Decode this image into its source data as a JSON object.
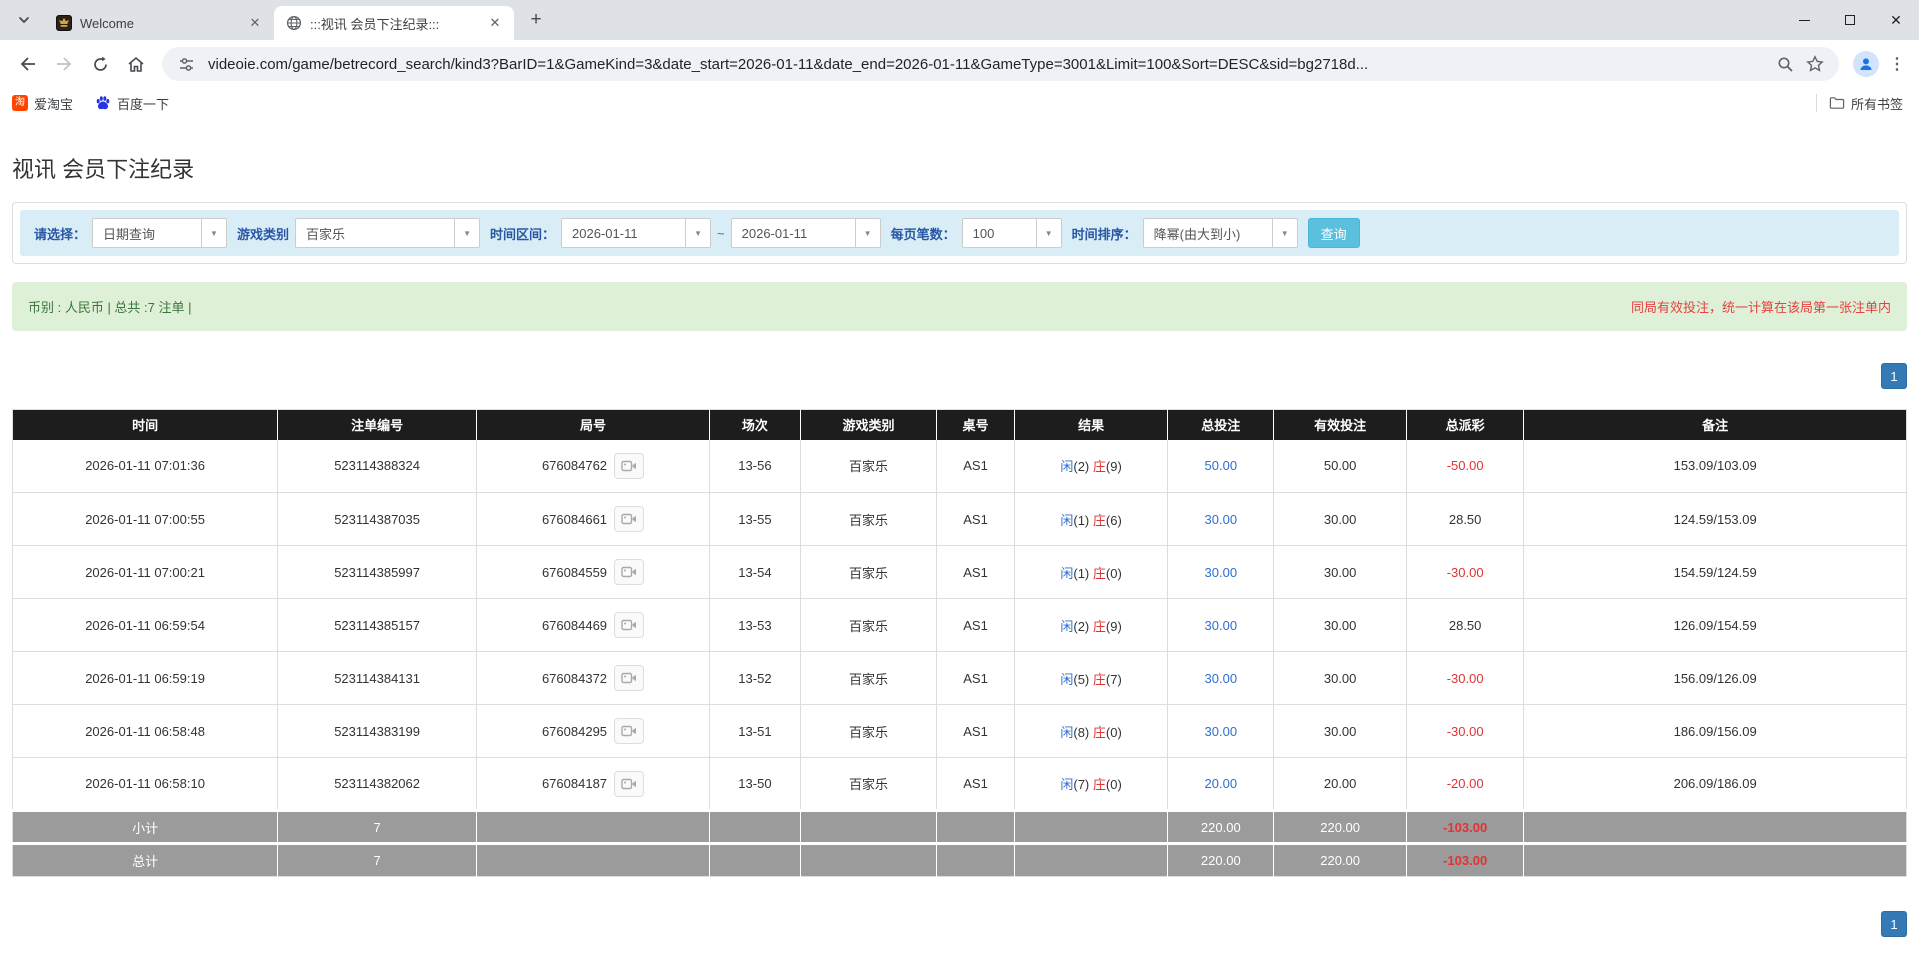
{
  "browser": {
    "tabs": [
      {
        "title": "Welcome"
      },
      {
        "title": ":::视讯 会员下注纪录:::"
      }
    ],
    "url": "videoie.com/game/betrecord_search/kind3?BarID=1&GameKind=3&date_start=2026-01-11&date_end=2026-01-11&GameType=3001&Limit=100&Sort=DESC&sid=bg2718d...",
    "bookmarks": [
      {
        "label": "爱淘宝",
        "icon_text": "淘"
      },
      {
        "label": "百度一下"
      }
    ],
    "all_bookmarks_label": "所有书签"
  },
  "page": {
    "title": "视讯 会员下注纪录",
    "filters": {
      "select_label": "请选择：",
      "select_value": "日期查询",
      "game_kind_label": "游戏类别",
      "game_kind_value": "百家乐",
      "date_range_label": "时间区间：",
      "date_start": "2026-01-11",
      "date_separator": "~",
      "date_end": "2026-01-11",
      "per_page_label": "每页笔数：",
      "per_page_value": "100",
      "sort_label": "时间排序：",
      "sort_value": "降幂(由大到小)",
      "search_button": "查询"
    },
    "summary": {
      "left": "币别 : 人民币 | 总共 :7 注单 |",
      "right": "同局有效投注，统一计算在该局第一张注单内"
    },
    "pagination": "1",
    "table": {
      "headers": [
        "时间",
        "注单编号",
        "局号",
        "场次",
        "游戏类别",
        "桌号",
        "结果",
        "总投注",
        "有效投注",
        "总派彩",
        "备注"
      ],
      "rows": [
        {
          "time": "2026-01-11 07:01:36",
          "bet_no": "523114388324",
          "round_no": "676084762",
          "session": "13-56",
          "game": "百家乐",
          "table": "AS1",
          "player": "闲",
          "player_score": "(2)",
          "banker": "庄",
          "banker_score": "(9)",
          "total_bet": "50.00",
          "valid_bet": "50.00",
          "payout": "-50.00",
          "note": "153.09/103.09"
        },
        {
          "time": "2026-01-11 07:00:55",
          "bet_no": "523114387035",
          "round_no": "676084661",
          "session": "13-55",
          "game": "百家乐",
          "table": "AS1",
          "player": "闲",
          "player_score": "(1)",
          "banker": "庄",
          "banker_score": "(6)",
          "total_bet": "30.00",
          "valid_bet": "30.00",
          "payout": "28.50",
          "note": "124.59/153.09"
        },
        {
          "time": "2026-01-11 07:00:21",
          "bet_no": "523114385997",
          "round_no": "676084559",
          "session": "13-54",
          "game": "百家乐",
          "table": "AS1",
          "player": "闲",
          "player_score": "(1)",
          "banker": "庄",
          "banker_score": "(0)",
          "total_bet": "30.00",
          "valid_bet": "30.00",
          "payout": "-30.00",
          "note": "154.59/124.59"
        },
        {
          "time": "2026-01-11 06:59:54",
          "bet_no": "523114385157",
          "round_no": "676084469",
          "session": "13-53",
          "game": "百家乐",
          "table": "AS1",
          "player": "闲",
          "player_score": "(2)",
          "banker": "庄",
          "banker_score": "(9)",
          "total_bet": "30.00",
          "valid_bet": "30.00",
          "payout": "28.50",
          "note": "126.09/154.59"
        },
        {
          "time": "2026-01-11 06:59:19",
          "bet_no": "523114384131",
          "round_no": "676084372",
          "session": "13-52",
          "game": "百家乐",
          "table": "AS1",
          "player": "闲",
          "player_score": "(5)",
          "banker": "庄",
          "banker_score": "(7)",
          "total_bet": "30.00",
          "valid_bet": "30.00",
          "payout": "-30.00",
          "note": "156.09/126.09"
        },
        {
          "time": "2026-01-11 06:58:48",
          "bet_no": "523114383199",
          "round_no": "676084295",
          "session": "13-51",
          "game": "百家乐",
          "table": "AS1",
          "player": "闲",
          "player_score": "(8)",
          "banker": "庄",
          "banker_score": "(0)",
          "total_bet": "30.00",
          "valid_bet": "30.00",
          "payout": "-30.00",
          "note": "186.09/156.09"
        },
        {
          "time": "2026-01-11 06:58:10",
          "bet_no": "523114382062",
          "round_no": "676084187",
          "session": "13-50",
          "game": "百家乐",
          "table": "AS1",
          "player": "闲",
          "player_score": "(7)",
          "banker": "庄",
          "banker_score": "(0)",
          "total_bet": "20.00",
          "valid_bet": "20.00",
          "payout": "-20.00",
          "note": "206.09/186.09"
        }
      ],
      "footer": [
        {
          "label": "小计",
          "count": "7",
          "total_bet": "220.00",
          "valid_bet": "220.00",
          "payout": "-103.00"
        },
        {
          "label": "总计",
          "count": "7",
          "total_bet": "220.00",
          "valid_bet": "220.00",
          "payout": "-103.00"
        }
      ]
    }
  }
}
